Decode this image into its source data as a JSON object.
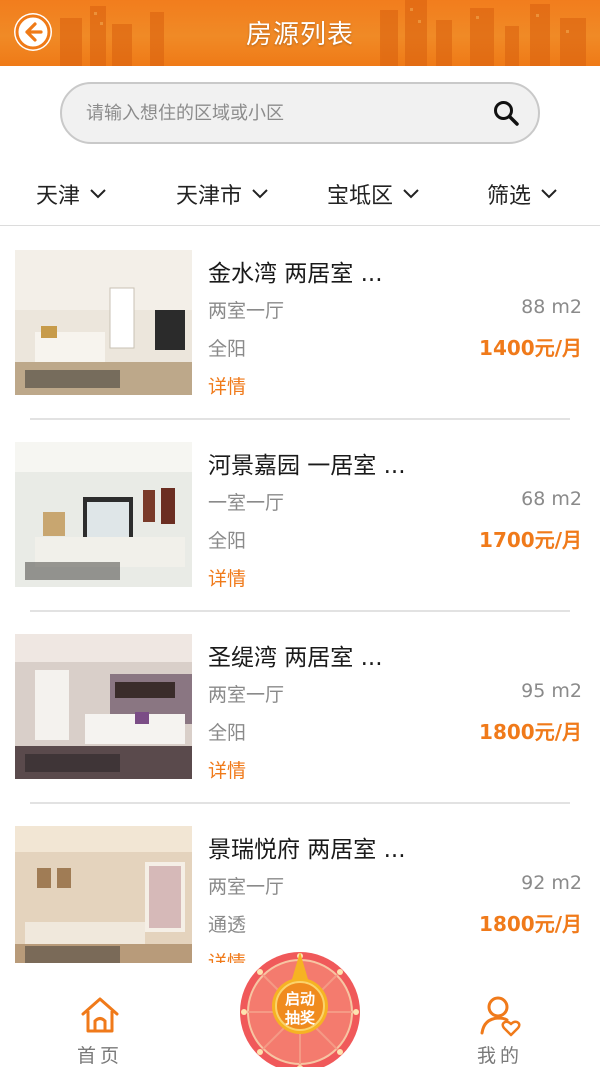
{
  "header": {
    "title": "房源列表",
    "back_icon": "back-arrow-icon",
    "color": "#f27d1d"
  },
  "search": {
    "placeholder": "请输入想住的区域或小区",
    "value": "",
    "icon": "search-icon"
  },
  "filters": [
    {
      "label": "天津"
    },
    {
      "label": "天津市"
    },
    {
      "label": "宝坻区"
    },
    {
      "label": "筛选"
    }
  ],
  "listings": [
    {
      "title": "金水湾 两居室 ...",
      "layout": "两室一厅",
      "area": "88 m2",
      "orientation": "全阳",
      "price": "1400元/月",
      "detail": "详情"
    },
    {
      "title": "河景嘉园 一居室 ...",
      "layout": "一室一厅",
      "area": "68 m2",
      "orientation": "全阳",
      "price": "1700元/月",
      "detail": "详情"
    },
    {
      "title": "圣缇湾 两居室 ...",
      "layout": "两室一厅",
      "area": "95 m2",
      "orientation": "全阳",
      "price": "1800元/月",
      "detail": "详情"
    },
    {
      "title": "景瑞悦府 两居室 ...",
      "layout": "两室一厅",
      "area": "92 m2",
      "orientation": "通透",
      "price": "1800元/月",
      "detail": "详情"
    }
  ],
  "nav": {
    "home": {
      "label": "首页",
      "icon": "home-icon"
    },
    "lottery": {
      "line1": "启动",
      "line2": "抽奖",
      "icon": "prize-wheel-icon"
    },
    "mine": {
      "label": "我的",
      "icon": "user-heart-icon"
    }
  },
  "colors": {
    "accent": "#f07a1a",
    "text_muted": "#8a8a8a"
  }
}
